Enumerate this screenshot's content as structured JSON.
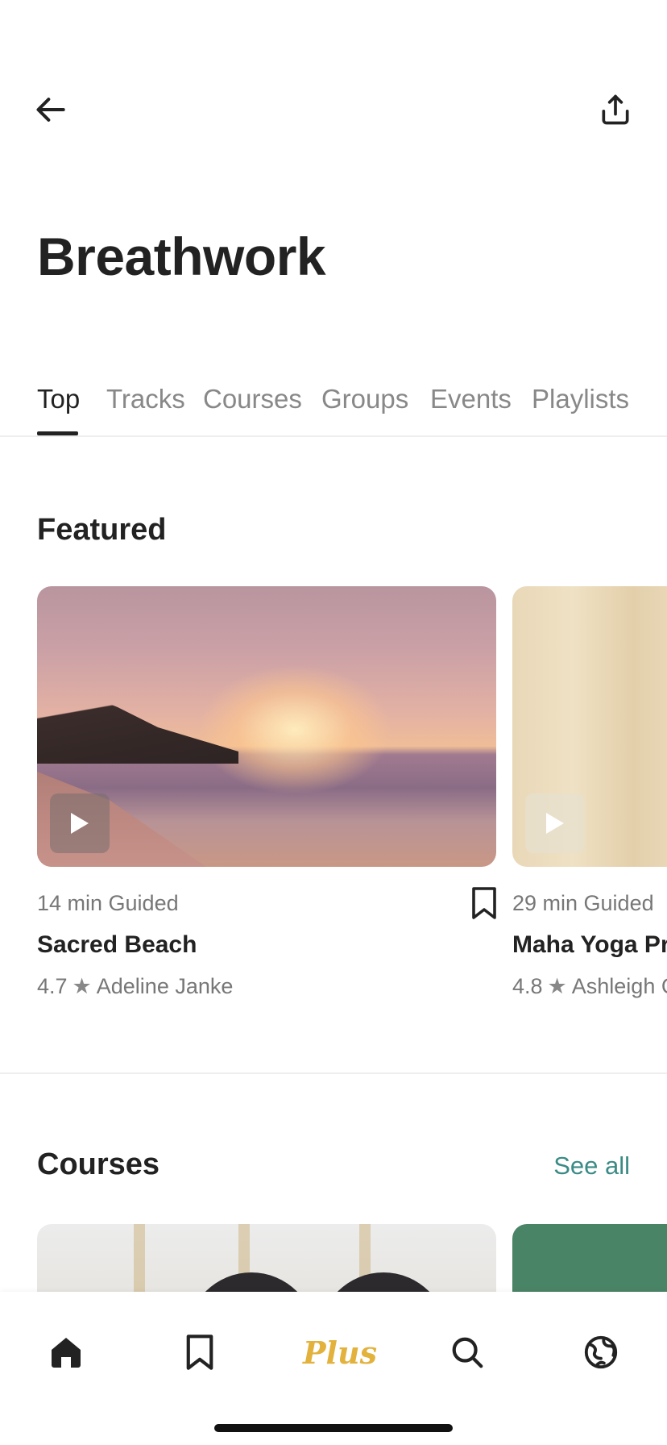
{
  "header": {
    "back_icon": "arrow-left-icon",
    "share_icon": "share-icon",
    "title": "Breathwork"
  },
  "tabs": [
    {
      "label": "Top",
      "active": true
    },
    {
      "label": "Tracks",
      "active": false
    },
    {
      "label": "Courses",
      "active": false
    },
    {
      "label": "Groups",
      "active": false
    },
    {
      "label": "Events",
      "active": false
    },
    {
      "label": "Playlists",
      "active": false
    }
  ],
  "featured": {
    "title": "Featured",
    "cards": [
      {
        "meta": "14 min Guided",
        "name": "Sacred Beach",
        "rating": "4.7",
        "author": "Adeline Janke",
        "image": "sunset-beach",
        "bookmark_icon": "bookmark-icon",
        "play_icon": "play-icon"
      },
      {
        "meta": "29 min Guided",
        "name": "Maha Yoga Pra",
        "rating": "4.8",
        "author": "Ashleigh C",
        "image": "woman-portrait",
        "play_icon": "play-icon"
      }
    ]
  },
  "courses": {
    "title": "Courses",
    "see_all": "See all"
  },
  "bottom_nav": {
    "items": [
      {
        "icon": "home-icon",
        "active": true
      },
      {
        "icon": "bookmark-icon",
        "active": false
      },
      {
        "label": "Plus",
        "accent": "#e2b23d"
      },
      {
        "icon": "search-icon",
        "active": false
      },
      {
        "icon": "globe-icon",
        "active": false
      }
    ]
  },
  "colors": {
    "accent_link": "#3a8b86",
    "plus_gold": "#e2b23d",
    "text_primary": "#222222",
    "text_secondary": "#777777"
  }
}
